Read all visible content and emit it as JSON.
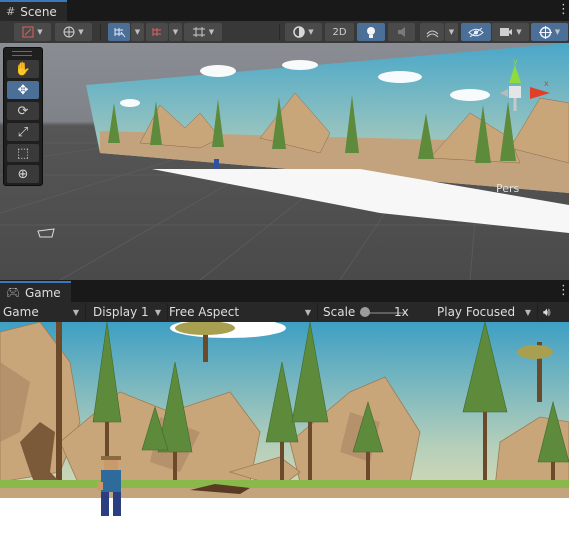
{
  "scene_tab": {
    "label": "Scene",
    "icon": "grid-icon"
  },
  "game_tab": {
    "label": "Game",
    "icon": "gamepad-icon"
  },
  "scene_toolbar": {
    "mode_2d": "2D",
    "icons": [
      "transform-handle-icon",
      "global-icon",
      "snap-grid-icon",
      "snap-increment-icon",
      "grid-plane-icon",
      "shading-mode-icon",
      "lighting-icon",
      "audio-icon",
      "effects-icon",
      "visibility-icon",
      "camera-icon",
      "gizmos-icon"
    ]
  },
  "tools": [
    "hand-tool-icon",
    "move-tool-icon",
    "rotate-tool-icon",
    "scale-tool-icon",
    "rect-tool-icon",
    "transform-tool-icon"
  ],
  "orientation_gizmo": {
    "axis_y": "y",
    "axis_x": "x",
    "projection": "Pers"
  },
  "game_toolbar": {
    "view": "Game",
    "display": "Display 1",
    "aspect": "Free Aspect",
    "scale_label": "Scale",
    "scale_value": "1x",
    "play_mode": "Play Focused",
    "scale_fraction": 0
  },
  "colors": {
    "accent_blue": "#4c6f97",
    "tab_highlight": "#3a79bb",
    "sky_top": "#4aa7c9",
    "sky_bottom": "#c7d6b9",
    "rock": "#c9a67a",
    "tree": "#5e8a3c"
  }
}
